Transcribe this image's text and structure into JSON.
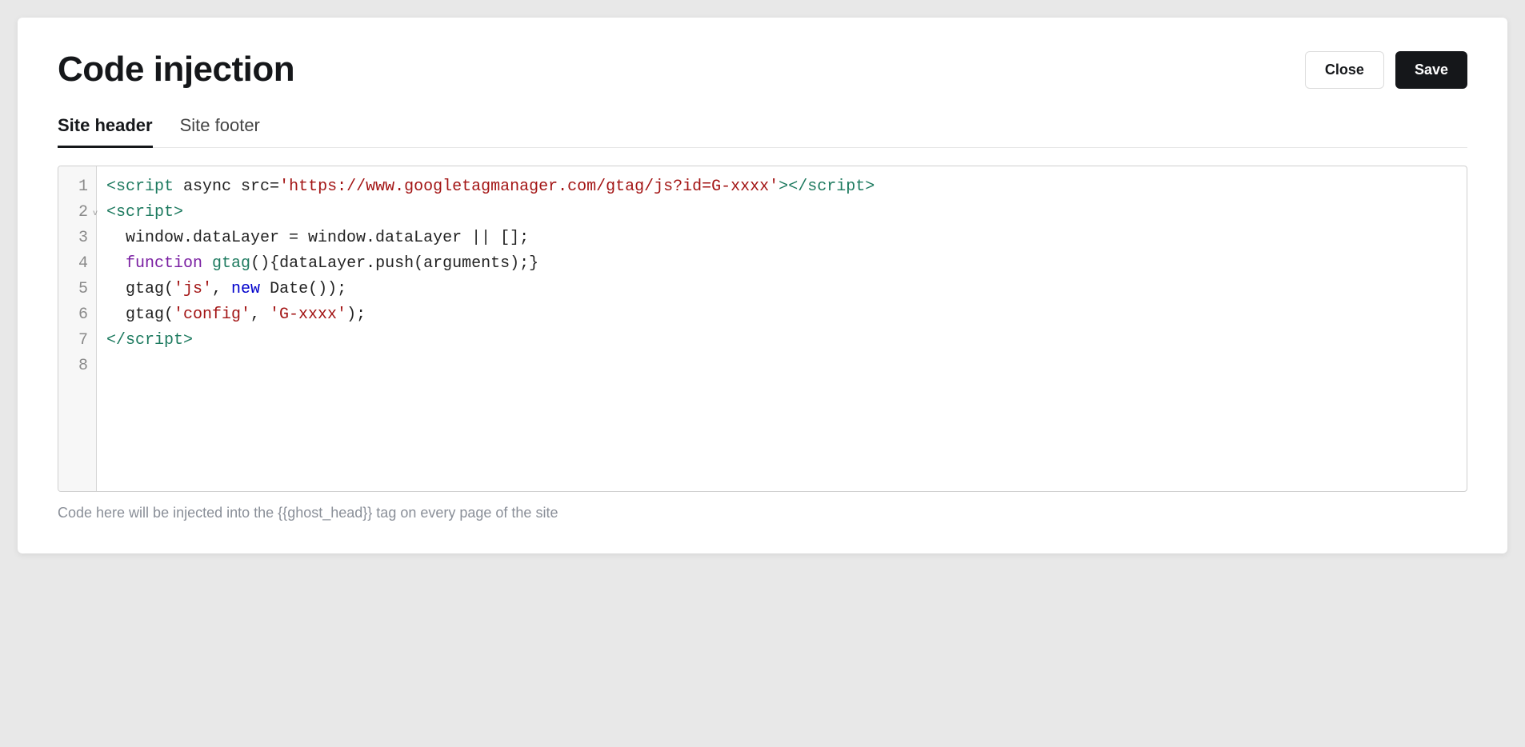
{
  "header": {
    "title": "Code injection",
    "close_label": "Close",
    "save_label": "Save"
  },
  "tabs": {
    "site_header": "Site header",
    "site_footer": "Site footer"
  },
  "editor": {
    "line_numbers": [
      "1",
      "2",
      "3",
      "4",
      "5",
      "6",
      "7",
      "8"
    ],
    "fold_marker": "v",
    "code_lines": [
      {
        "tokens": [
          {
            "t": "<",
            "c": "tok-tag"
          },
          {
            "t": "script",
            "c": "tok-tag"
          },
          {
            "t": " async src=",
            "c": "tok-attr"
          },
          {
            "t": "'https://www.googletagmanager.com/gtag/js?id=G-xxxx'",
            "c": "tok-str"
          },
          {
            "t": ">",
            "c": "tok-tag"
          },
          {
            "t": "</",
            "c": "tok-tag"
          },
          {
            "t": "script",
            "c": "tok-tag"
          },
          {
            "t": ">",
            "c": "tok-tag"
          }
        ]
      },
      {
        "tokens": [
          {
            "t": "<",
            "c": "tok-tag"
          },
          {
            "t": "script",
            "c": "tok-tag"
          },
          {
            "t": ">",
            "c": "tok-tag"
          }
        ]
      },
      {
        "tokens": [
          {
            "t": "  window.dataLayer = window.dataLayer || [];",
            "c": ""
          }
        ]
      },
      {
        "tokens": [
          {
            "t": "  ",
            "c": ""
          },
          {
            "t": "function",
            "c": "tok-kw"
          },
          {
            "t": " ",
            "c": ""
          },
          {
            "t": "gtag",
            "c": "tok-fn"
          },
          {
            "t": "(){dataLayer.push(arguments);}",
            "c": ""
          }
        ]
      },
      {
        "tokens": [
          {
            "t": "  gtag(",
            "c": ""
          },
          {
            "t": "'js'",
            "c": "tok-str"
          },
          {
            "t": ", ",
            "c": ""
          },
          {
            "t": "new",
            "c": "tok-kw2"
          },
          {
            "t": " Date());",
            "c": ""
          }
        ]
      },
      {
        "tokens": [
          {
            "t": "  gtag(",
            "c": ""
          },
          {
            "t": "'config'",
            "c": "tok-str"
          },
          {
            "t": ", ",
            "c": ""
          },
          {
            "t": "'G-xxxx'",
            "c": "tok-str"
          },
          {
            "t": ");",
            "c": ""
          }
        ]
      },
      {
        "tokens": [
          {
            "t": "</",
            "c": "tok-tag"
          },
          {
            "t": "script",
            "c": "tok-tag"
          },
          {
            "t": ">",
            "c": "tok-tag"
          }
        ]
      },
      {
        "tokens": [
          {
            "t": "",
            "c": ""
          }
        ]
      }
    ]
  },
  "hint": "Code here will be injected into the {{ghost_head}} tag on every page of the site"
}
